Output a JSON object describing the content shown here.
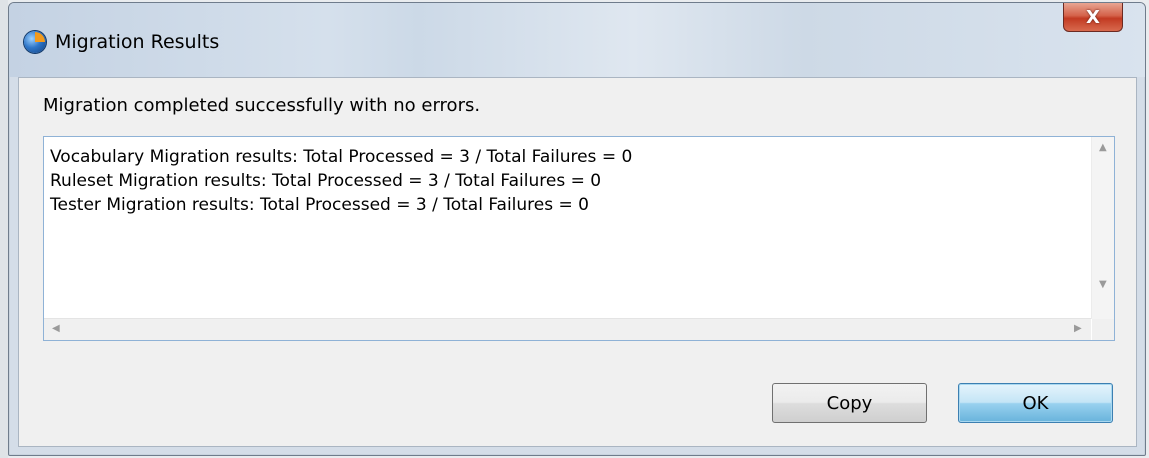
{
  "window": {
    "title": "Migration Results",
    "close_label": "X",
    "app_icon": "eclipse-app-icon"
  },
  "dialog": {
    "message": "Migration completed successfully with no errors.",
    "results": [
      "Vocabulary Migration results: Total Processed = 3 / Total Failures = 0",
      "Ruleset Migration results: Total Processed = 3 / Total Failures = 0",
      "Tester Migration results: Total Processed = 3 / Total Failures = 0"
    ]
  },
  "buttons": {
    "copy_label": "Copy",
    "ok_label": "OK"
  },
  "colors": {
    "ok_button_accent": "#68b3db",
    "close_button": "#c23a22"
  }
}
